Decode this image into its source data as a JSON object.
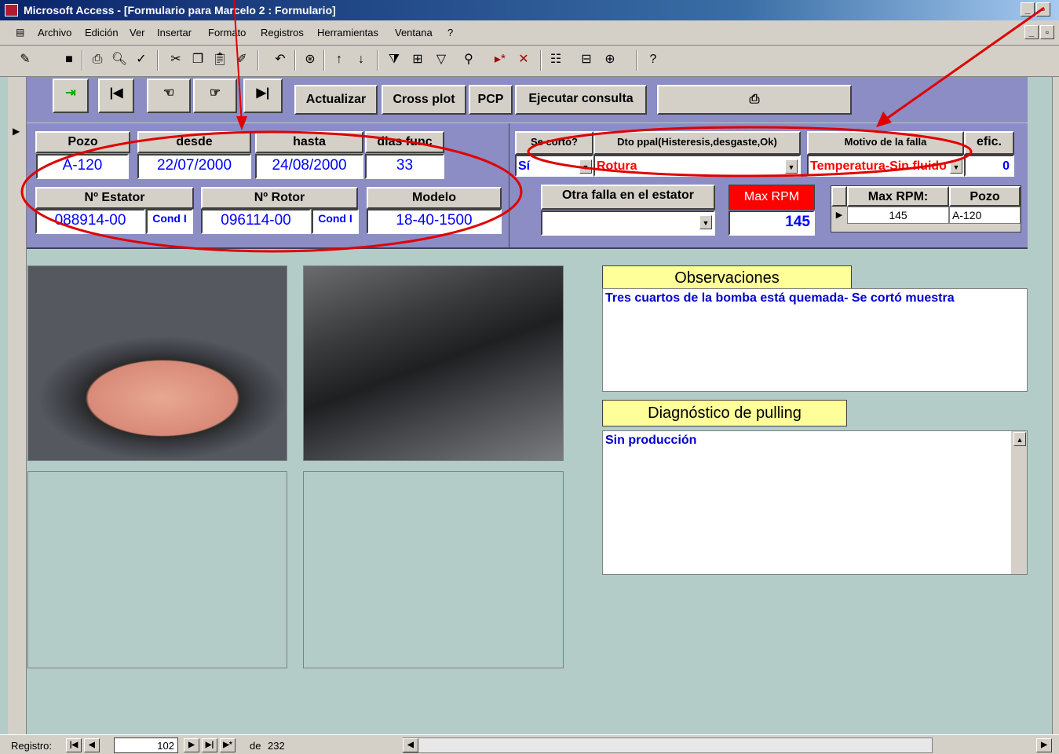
{
  "window": {
    "title": "Microsoft Access - [Formulario para Marcelo 2 : Formulario]"
  },
  "menu": [
    "Archivo",
    "Edición",
    "Ver",
    "Insertar",
    "Formato",
    "Registros",
    "Herramientas",
    "Ventana",
    "?"
  ],
  "form_buttons": {
    "actualizar": "Actualizar",
    "cross_plot": "Cross plot",
    "pcp": "PCP",
    "ejecutar": "Ejecutar consulta"
  },
  "fields": {
    "pozo_label": "Pozo",
    "pozo": "A-120",
    "desde_label": "desde",
    "desde": "22/07/2000",
    "hasta_label": "hasta",
    "hasta": "24/08/2000",
    "dias_label": "dias func",
    "dias": "33",
    "estator_label": "Nº Estator",
    "estator": "088914-00",
    "estator_cond": "Cond I",
    "rotor_label": "Nº Rotor",
    "rotor": "096114-00",
    "rotor_cond": "Cond I",
    "modelo_label": "Modelo",
    "modelo": "18-40-1500",
    "se_corto_label": "Se cortó?",
    "se_corto": "Sí",
    "dto_label": "Dto ppal(Histeresis,desgaste,Ok)",
    "dto": "Rotura",
    "motivo_label": "Motivo de la falla",
    "motivo": "Temperatura-Sin fluido",
    "efic_label": "efic.",
    "efic": "0",
    "otra_falla_label": "Otra falla en el estator",
    "otra_falla": "",
    "max_rpm_label": "Max RPM",
    "max_rpm": "145"
  },
  "subgrid": {
    "headers": [
      "Max RPM:",
      "Pozo"
    ],
    "row": [
      "145",
      "A-120"
    ]
  },
  "observaciones": {
    "title": "Observaciones",
    "text": "Tres cuartos de la bomba está quemada- Se cortó muestra"
  },
  "diagnostico": {
    "title": "Diagnóstico de pulling",
    "text": "Sin producción"
  },
  "status": {
    "registro_label": "Registro:",
    "current": "102",
    "de": "de",
    "total": "232"
  },
  "colors": {
    "form_band": "#8b8dc4",
    "annotation": "#e00000",
    "max_rpm_bg": "#ff0000"
  }
}
